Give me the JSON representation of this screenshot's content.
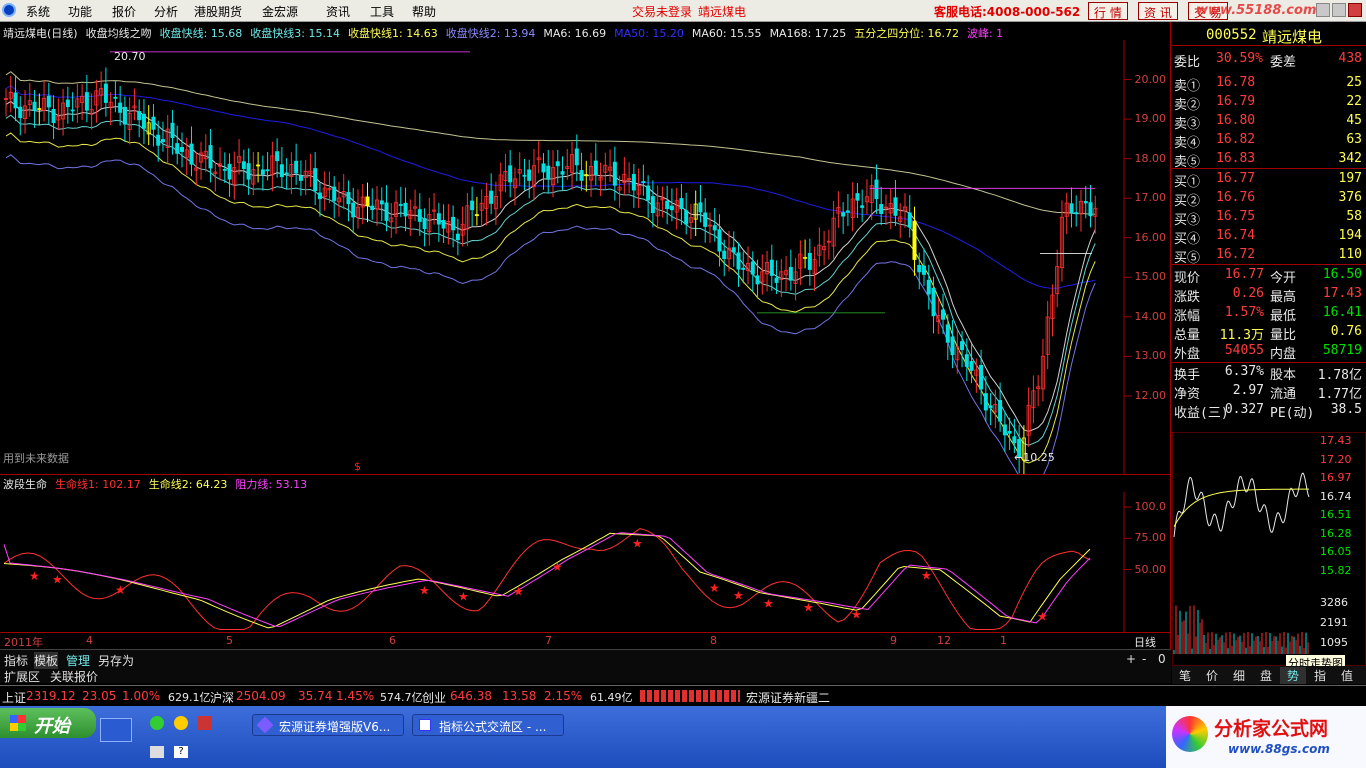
{
  "menu": {
    "items": [
      "系统",
      "功能",
      "报价",
      "分析",
      "港股期货",
      "金宏源",
      "资讯",
      "工具",
      "帮助"
    ],
    "notice1": "交易未登录",
    "notice2": "靖远煤电",
    "hotline": "客服电话:4008-000-562",
    "buttons": [
      "行 情",
      "资 讯",
      "交 易"
    ],
    "watermark": "www.55188.com"
  },
  "chart": {
    "legend_items": [
      {
        "text": "靖远煤电(日线)",
        "color": "#e8e8e8"
      },
      {
        "text": "收盘均线之吻",
        "color": "#e8e8e8"
      },
      {
        "text": "收盘快线: 15.68",
        "color": "#6fe8e8"
      },
      {
        "text": "收盘快线3: 15.14",
        "color": "#6fe8e8"
      },
      {
        "text": "收盘快线1: 14.63",
        "color": "#ffff54"
      },
      {
        "text": "收盘快线2: 13.94",
        "color": "#8b8bff"
      },
      {
        "text": "MA6: 16.69",
        "color": "#e8e8e8"
      },
      {
        "text": "MA50: 15.20",
        "color": "#3030ff"
      },
      {
        "text": "MA60: 15.55",
        "color": "#e8e8e8"
      },
      {
        "text": "MA168: 17.25",
        "color": "#e8e8e8"
      },
      {
        "text": "五分之四分位: 16.72",
        "color": "#ffff54"
      },
      {
        "text": "波峰: 1",
        "color": "#ff40ff"
      }
    ],
    "high_label": "20.70",
    "low_label": "←10.25",
    "future_note": "用到未来数据",
    "dollar": "$",
    "y_labels": [
      "20.00",
      "19.00",
      "18.00",
      "17.00",
      "16.00",
      "15.00",
      "14.00",
      "13.00",
      "12.00"
    ],
    "osc_labels": [
      "100.0",
      "75.00",
      "50.00"
    ],
    "osc_legend": [
      {
        "text": "波段生命",
        "color": "#e8e8e8"
      },
      {
        "text": "生命线1: 102.17",
        "color": "#ff3030"
      },
      {
        "text": "生命线2: 64.23",
        "color": "#ffff54"
      },
      {
        "text": "阻力线: 53.13",
        "color": "#ff40ff"
      }
    ],
    "x_labels": [
      "2011年",
      "4",
      "5",
      "6",
      "7",
      "8",
      "9",
      "12",
      "1"
    ],
    "period": "日线"
  },
  "chart_data": {
    "type": "candlestick",
    "symbol": "000552",
    "name": "靖远煤电",
    "period": "日线",
    "ylim": [
      10,
      21
    ],
    "high": 20.7,
    "low": 10.25,
    "close_ma_values": {
      "收盘快线": 15.68,
      "收盘快线3": 15.14,
      "收盘快线1": 14.63,
      "收盘快线2": 13.94,
      "MA6": 16.69,
      "MA50": 15.2,
      "MA60": 15.55,
      "MA168": 17.25,
      "五分之四分位": 16.72
    },
    "oscillator": {
      "name": "波段生命",
      "ylim": [
        0,
        110
      ],
      "生命线1": 102.17,
      "生命线2": 64.23,
      "阻力线": 53.13
    }
  },
  "quote": {
    "code": "000552",
    "name": "靖远煤电",
    "webi": {
      "label": "委比",
      "value": "30.59%",
      "label2": "委差",
      "value2": "438"
    },
    "sell": [
      {
        "label": "卖⑤",
        "price": "16.83",
        "vol": "342"
      },
      {
        "label": "卖④",
        "price": "16.82",
        "vol": "63"
      },
      {
        "label": "卖③",
        "price": "16.80",
        "vol": "45"
      },
      {
        "label": "卖②",
        "price": "16.79",
        "vol": "22"
      },
      {
        "label": "卖①",
        "price": "16.78",
        "vol": "25"
      }
    ],
    "buy": [
      {
        "label": "买①",
        "price": "16.77",
        "vol": "197"
      },
      {
        "label": "买②",
        "price": "16.76",
        "vol": "376"
      },
      {
        "label": "买③",
        "price": "16.75",
        "vol": "58"
      },
      {
        "label": "买④",
        "price": "16.74",
        "vol": "194"
      },
      {
        "label": "买⑤",
        "price": "16.72",
        "vol": "110"
      }
    ],
    "stats": [
      {
        "l1": "现价",
        "v1": "16.77",
        "c1": "red",
        "l2": "今开",
        "v2": "16.50",
        "c2": "grn"
      },
      {
        "l1": "涨跌",
        "v1": "0.26",
        "c1": "red",
        "l2": "最高",
        "v2": "17.43",
        "c2": "red"
      },
      {
        "l1": "涨幅",
        "v1": "1.57%",
        "c1": "red",
        "l2": "最低",
        "v2": "16.41",
        "c2": "grn"
      },
      {
        "l1": "总量",
        "v1": "11.3万",
        "c1": "yel",
        "l2": "量比",
        "v2": "0.76",
        "c2": "yel"
      },
      {
        "l1": "外盘",
        "v1": "54055",
        "c1": "red",
        "l2": "内盘",
        "v2": "58719",
        "c2": "grn"
      },
      {
        "l1": "换手",
        "v1": "6.37%",
        "c1": "wht",
        "l2": "股本",
        "v2": "1.78亿",
        "c2": "wht"
      },
      {
        "l1": "净资",
        "v1": "2.97",
        "c1": "wht",
        "l2": "流通",
        "v2": "1.77亿",
        "c2": "wht"
      },
      {
        "l1": "收益(三)",
        "v1": "0.327",
        "c1": "wht",
        "l2": "PE(动)",
        "v2": "38.5",
        "c2": "wht"
      }
    ]
  },
  "mini": {
    "labels": [
      "17.43",
      "17.20",
      "16.97",
      "16.74",
      "16.51",
      "16.28",
      "16.05",
      "15.82"
    ],
    "vol_labels": [
      "3286",
      "2191",
      "1095"
    ],
    "tooltip": "分时走势图"
  },
  "bottom": {
    "tabs1": [
      "指标",
      "模板",
      "管理",
      "另存为"
    ],
    "tabs2": [
      "扩展区",
      "关联报价"
    ],
    "right_tabs": [
      "笔",
      "价",
      "细",
      "盘",
      "势",
      "指",
      "值"
    ],
    "zoom": [
      "+",
      "-",
      "0"
    ]
  },
  "status": {
    "sh": {
      "name": "上证",
      "val": "2319.12",
      "chg": "23.05",
      "pct": "1.00%",
      "amt": "629.1亿"
    },
    "sz": {
      "name": "沪深",
      "val": "2504.09",
      "chg": "35.74",
      "pct": "1.45%",
      "amt": "574.7亿"
    },
    "cy": {
      "name": "创业",
      "val": "646.38",
      "chg": "13.58",
      "pct": "2.15%",
      "amt": "61.49亿"
    },
    "source": "宏源证券新疆二"
  },
  "taskbar": {
    "start": "开始",
    "tasks": [
      "宏源证券增强版V6...",
      "指标公式交流区 - ..."
    ],
    "brand": "分析家公式网",
    "brand_url": "www.88gs.com"
  }
}
